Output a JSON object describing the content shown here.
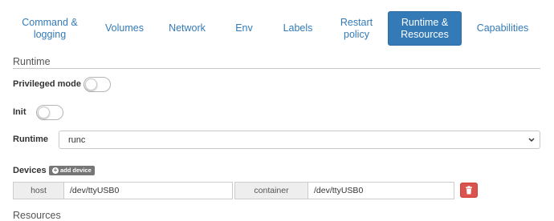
{
  "tabs": [
    {
      "line1": "Command &",
      "line2": "logging",
      "active": false
    },
    {
      "line1": "Volumes",
      "line2": "",
      "active": false
    },
    {
      "line1": "Network",
      "line2": "",
      "active": false
    },
    {
      "line1": "Env",
      "line2": "",
      "active": false
    },
    {
      "line1": "Labels",
      "line2": "",
      "active": false
    },
    {
      "line1": "Restart",
      "line2": "policy",
      "active": false
    },
    {
      "line1": "Runtime &",
      "line2": "Resources",
      "active": true
    },
    {
      "line1": "Capabilities",
      "line2": "",
      "active": false
    }
  ],
  "runtime_section": {
    "title": "Runtime",
    "privileged": {
      "label": "Privileged mode",
      "enabled": false
    },
    "init": {
      "label": "Init",
      "enabled": false
    },
    "runtime": {
      "label": "Runtime",
      "value": "runc"
    }
  },
  "devices": {
    "label": "Devices",
    "add_label": "add device",
    "rows": [
      {
        "host_label": "host",
        "host_value": "/dev/ttyUSB0",
        "container_label": "container",
        "container_value": "/dev/ttyUSB0"
      }
    ]
  },
  "resources_section": {
    "title": "Resources"
  },
  "icons": {
    "add": "plus-circle-icon",
    "delete": "trash-icon",
    "select": "chevron-down-icon"
  },
  "colors": {
    "accent": "#337ab7",
    "danger": "#d9534f",
    "add_button": "#767676"
  }
}
